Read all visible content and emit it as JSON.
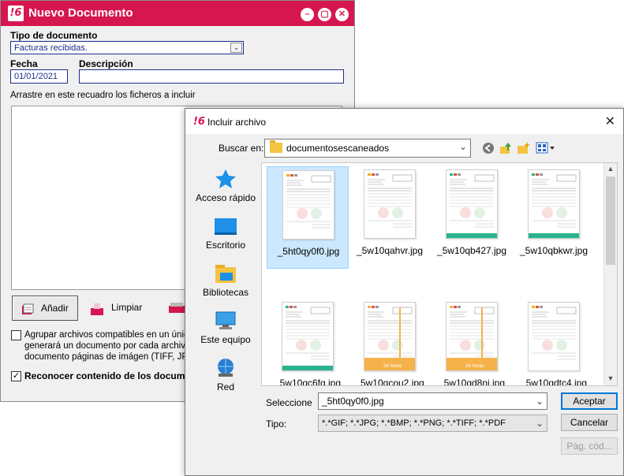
{
  "back_window": {
    "logo": "!6",
    "title": "Nuevo Documento",
    "tipo_label": "Tipo de documento",
    "tipo_value": "Facturas recibidas.",
    "fecha_label": "Fecha",
    "fecha_value": "01/01/2021",
    "descripcion_label": "Descripción",
    "descripcion_value": "",
    "drop_instruction": "Arrastre en este recuadro los ficheros a incluir",
    "add_button": "Añadir",
    "clear_button": "Limpiar",
    "group_checkbox_lines": [
      "Agrupar archivos compatibles en un único",
      "generará un documento por cada archivo;",
      "documento páginas de imágen (TIFF, JPG, ..."
    ],
    "group_checked": false,
    "recognize_label": "Reconocer contenido de los documen",
    "recognize_checked": true
  },
  "dialog": {
    "logo": "!6",
    "title": "Incluir archivo",
    "look_in_label": "Buscar en:",
    "look_in_value": "documentosescaneados",
    "places": [
      {
        "label": "Acceso rápido",
        "icon": "star-icon"
      },
      {
        "label": "Escritorio",
        "icon": "desktop-icon"
      },
      {
        "label": "Bibliotecas",
        "icon": "libraries-icon"
      },
      {
        "label": "Este equipo",
        "icon": "computer-icon"
      },
      {
        "label": "Red",
        "icon": "network-icon"
      }
    ],
    "files": [
      {
        "name": "_5ht0qy0f0.jpg",
        "selected": true,
        "style": "plain"
      },
      {
        "name": "_5w10qahvr.jpg",
        "selected": false,
        "style": "plain"
      },
      {
        "name": "_5w10qb427.jpg",
        "selected": false,
        "style": "green"
      },
      {
        "name": "_5w10qbkwr.jpg",
        "selected": false,
        "style": "green"
      },
      {
        "name": "_5w10qc6fg.jpg",
        "selected": false,
        "style": "green"
      },
      {
        "name": "_5w10qcou2.jpg",
        "selected": false,
        "style": "orange"
      },
      {
        "name": "_5w10qd8nj.jpg",
        "selected": false,
        "style": "orange"
      },
      {
        "name": "_5w10qdtc4.jpg",
        "selected": false,
        "style": "plain"
      }
    ],
    "thumb_banner_text": "24 horas",
    "filename_label": "Seleccione",
    "filename_value": "_5ht0qy0f0.jpg",
    "type_label": "Tipo:",
    "type_value": "*.*GIF; *.*JPG; *.*BMP; *.*PNG; *.*TIFF; *.*PDF",
    "accept_button": "Aceptar",
    "cancel_button": "Cancelar",
    "code_button": "Pág. cód..."
  },
  "colors": {
    "brand": "#d6164f",
    "field_border": "#1d2d8c",
    "selection": "#cce8ff",
    "green_band": "#2ab38e",
    "orange_band": "#f5b24a"
  }
}
